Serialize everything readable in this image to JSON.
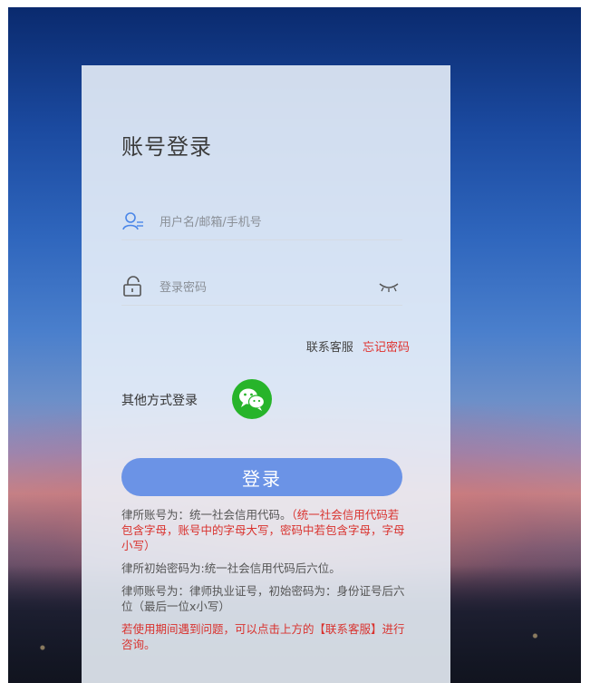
{
  "login": {
    "title": "账号登录",
    "username_placeholder": "用户名/邮箱/手机号",
    "password_placeholder": "登录密码",
    "contact_label": "联系客服",
    "forgot_label": "忘记密码",
    "other_login_label": "其他方式登录",
    "submit_label": "登录"
  },
  "notes": {
    "note1_gray": "律所账号为：统一社会信用代码。",
    "note1_red": "（统一社会信用代码若包含字母，账号中的字母大写，密码中若包含字母，字母小写）",
    "note2": "律所初始密码为:统一社会信用代码后六位。",
    "note3": "律师账号为：律师执业证号，初始密码为：身份证号后六位（最后一位x小写）",
    "note4": "若使用期间遇到问题，可以点击上方的【联系客服】进行咨询。"
  },
  "icons": {
    "user": "user-icon",
    "lock": "lock-icon",
    "eye": "eye-closed-icon",
    "wechat": "wechat-icon"
  },
  "colors": {
    "button": "#6b93e6",
    "link_red": "#e0312d",
    "wechat_green": "#27b42a"
  }
}
